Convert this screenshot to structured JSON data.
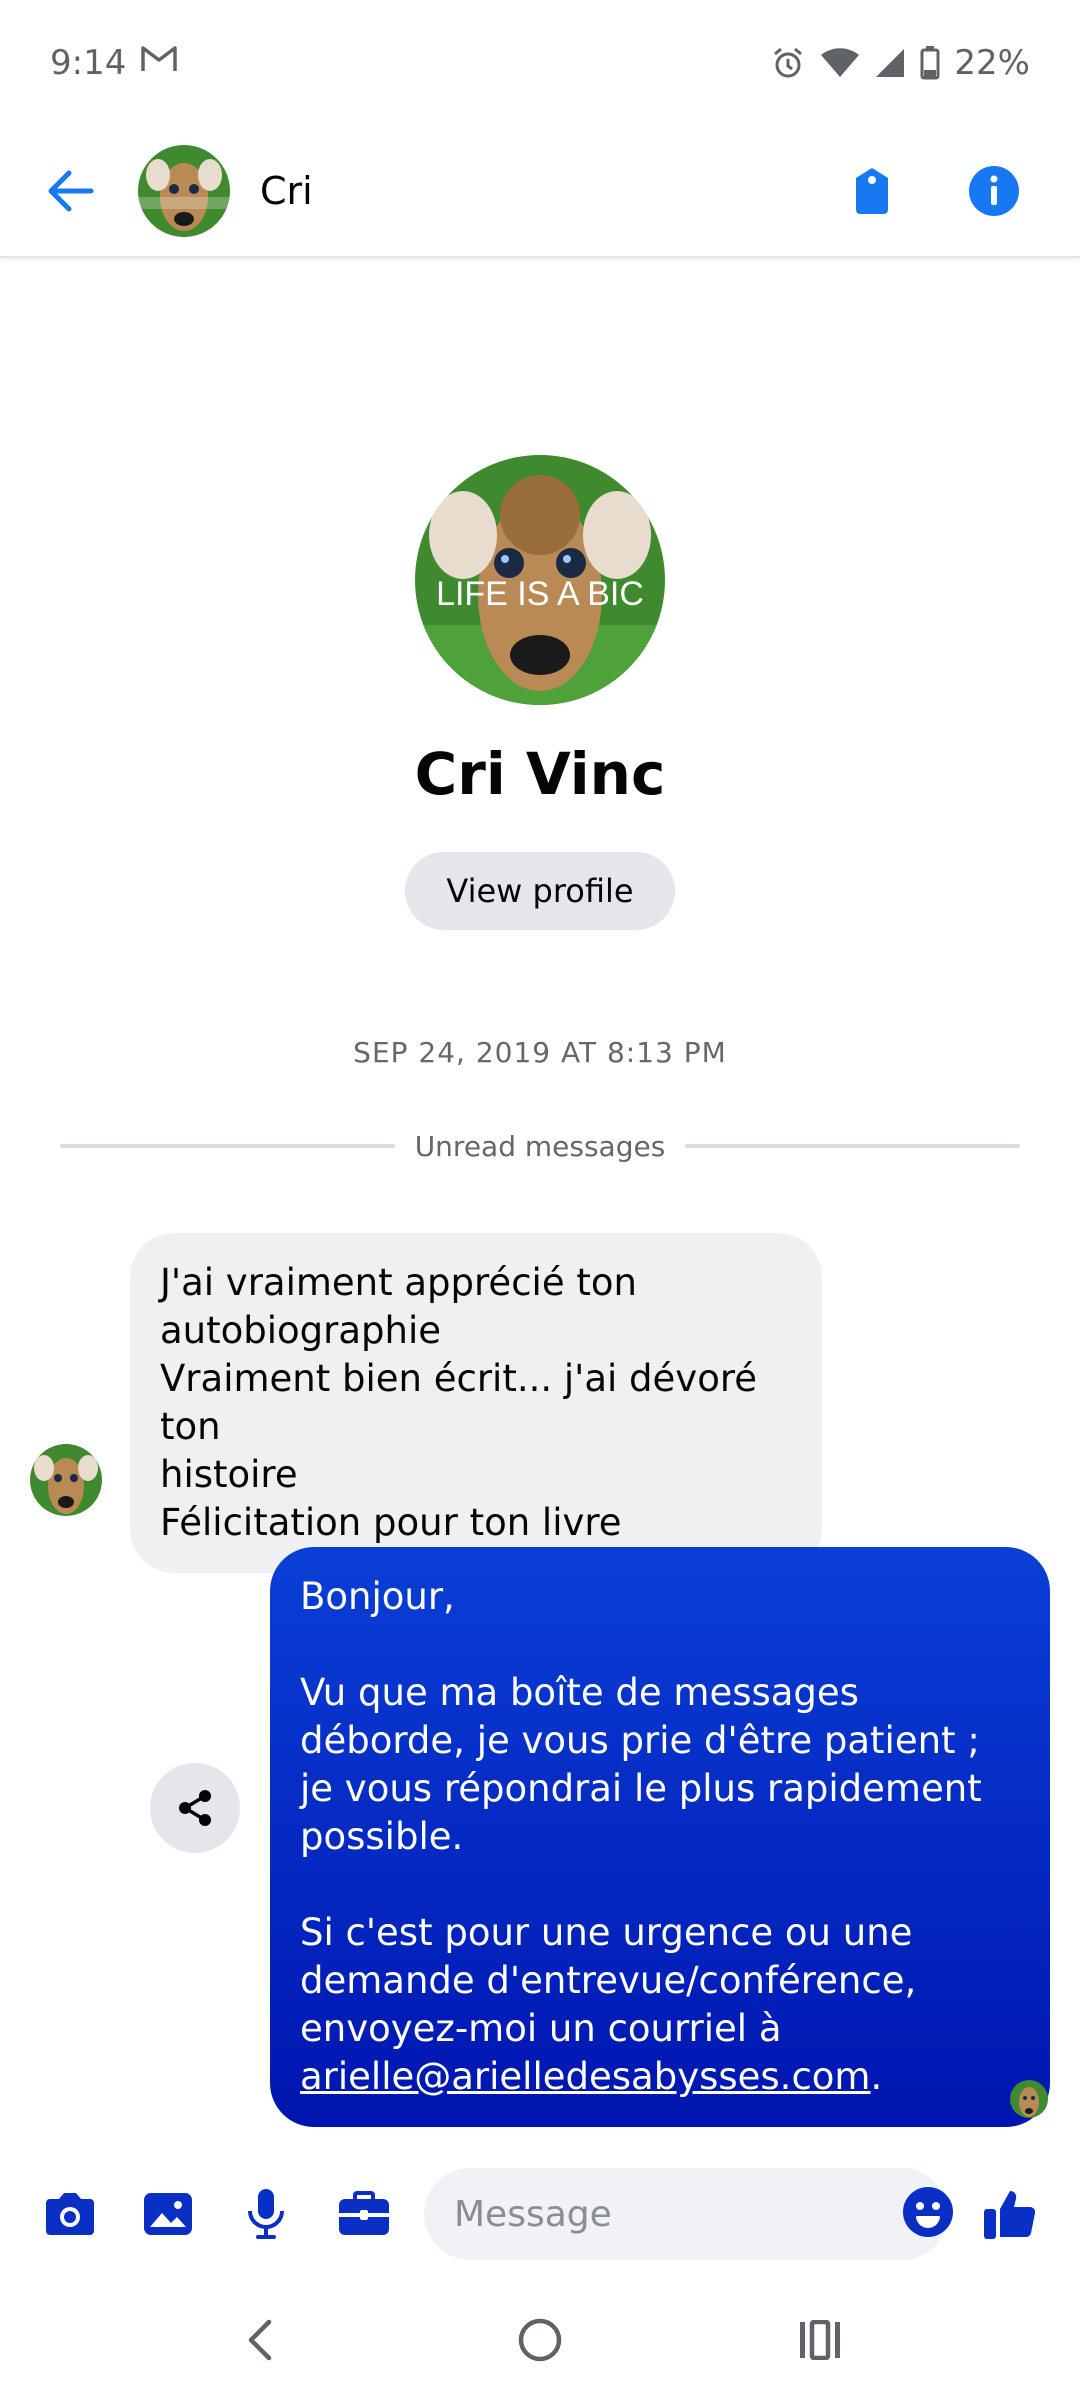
{
  "status_bar": {
    "time": "9:14",
    "battery": "22%"
  },
  "header": {
    "contact_short_name": "Cri"
  },
  "profile": {
    "full_name": "Cri Vinc",
    "view_profile_label": "View profile",
    "avatar_caption": "LIFE IS A BIC"
  },
  "thread": {
    "timestamp": "SEP 24, 2019 AT 8:13 PM",
    "unread_label": "Unread messages",
    "incoming": {
      "lines": [
        "J'ai vraiment apprécié ton",
        "autobiographie",
        "Vraiment bien écrit... j'ai dévoré ton",
        "histoire",
        "Félicitation pour ton livre"
      ]
    },
    "outgoing": {
      "greeting": "Bonjour,",
      "paragraph_1": "Vu que ma boîte de messages déborde, je vous prie d'être patient ; je vous répondrai le plus rapidement possible.",
      "paragraph_2_prefix": "Si c'est pour une urgence ou une demande d'entrevue/conférence, envoyez-moi un courriel à ",
      "email": "arielle@arielledesabysses.com",
      "paragraph_2_suffix": "."
    }
  },
  "composer": {
    "placeholder": "Message"
  },
  "colors": {
    "accent_blue": "#1877f2",
    "messenger_blue": "#0a2fc4",
    "bubble_in": "#f0f0f2"
  },
  "icons": {
    "back": "arrow-left-icon",
    "tag": "tag-icon",
    "info": "info-icon",
    "share": "share-icon",
    "camera": "camera-icon",
    "gallery": "image-icon",
    "mic": "microphone-icon",
    "briefcase": "briefcase-icon",
    "emoji": "emoji-icon",
    "like": "thumbs-up-icon"
  }
}
